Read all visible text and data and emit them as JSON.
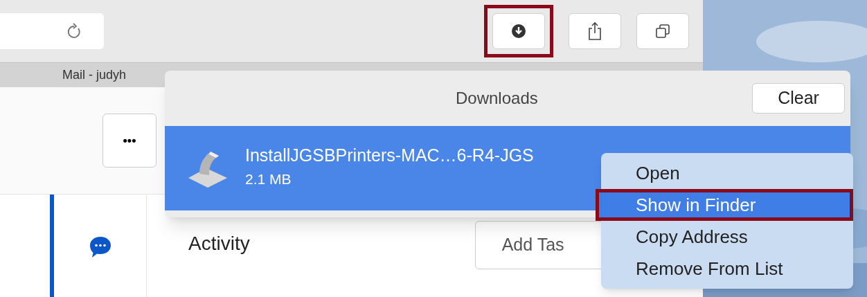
{
  "toolbar": {
    "buttons": [
      {
        "kind": "download",
        "highlighted": true
      },
      {
        "kind": "share",
        "highlighted": false
      },
      {
        "kind": "tabs",
        "highlighted": false
      }
    ]
  },
  "tab": {
    "label": "Mail - judyh"
  },
  "page": {
    "more_button": "•••",
    "heading": "Activity",
    "add_task_button": "Add Tas"
  },
  "downloads": {
    "title": "Downloads",
    "clear_button": "Clear",
    "items": [
      {
        "name": "InstallJGSBPrinters-MAC…6-R4-JGS",
        "size": "2.1 MB",
        "selected": true
      }
    ]
  },
  "context_menu": {
    "items": [
      {
        "label": "Open",
        "selected": false,
        "highlighted": false
      },
      {
        "label": "Show in Finder",
        "selected": true,
        "highlighted": true
      },
      {
        "label": "Copy Address",
        "selected": false,
        "highlighted": false
      },
      {
        "label": "Remove From List",
        "selected": false,
        "highlighted": false
      }
    ]
  }
}
